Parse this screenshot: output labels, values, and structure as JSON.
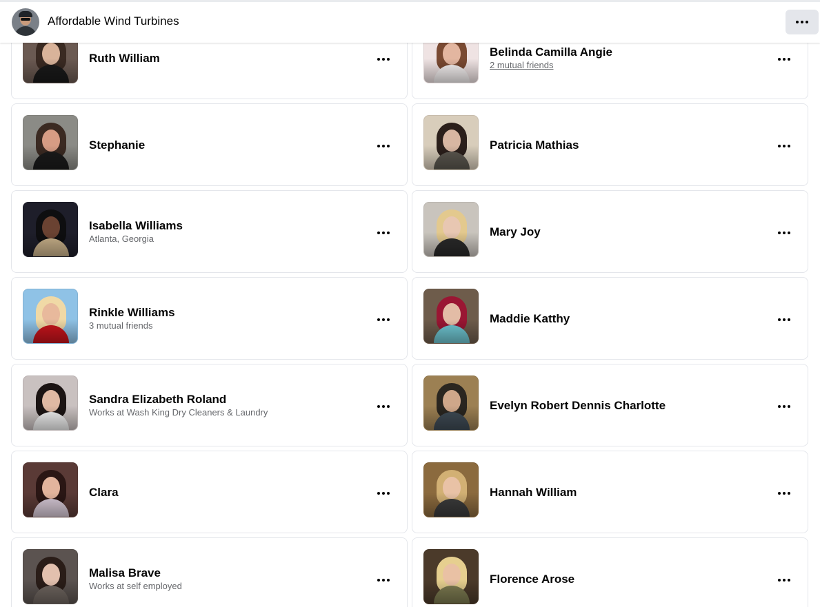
{
  "header": {
    "title": "Affordable Wind Turbines"
  },
  "people": [
    {
      "name": "Ruth William",
      "sub": "",
      "sub_link": false,
      "colors": {
        "bg": "#6b5a52",
        "hair": "#3a2a22",
        "skin": "#d9b39a",
        "cloth": "#1a1a1a"
      }
    },
    {
      "name": "Belinda Camilla Angie",
      "sub": "2 mutual friends",
      "sub_link": true,
      "colors": {
        "bg": "#efe3e3",
        "hair": "#7a4a32",
        "skin": "#e3b6a0",
        "cloth": "#f7f3f3"
      }
    },
    {
      "name": "Stephanie",
      "sub": "",
      "sub_link": false,
      "colors": {
        "bg": "#8b8b86",
        "hair": "#3b2a22",
        "skin": "#d69c84",
        "cloth": "#1b1b1b"
      }
    },
    {
      "name": "Patricia Mathias",
      "sub": "",
      "sub_link": false,
      "colors": {
        "bg": "#d8cdbb",
        "hair": "#2b1f1b",
        "skin": "#d8b6a2",
        "cloth": "#5c5850"
      }
    },
    {
      "name": "Isabella Williams",
      "sub": "Atlanta, Georgia",
      "sub_link": false,
      "colors": {
        "bg": "#1e1e2a",
        "hair": "#0e0e10",
        "skin": "#6a4232",
        "cloth": "#c8b18a"
      }
    },
    {
      "name": "Mary Joy",
      "sub": "",
      "sub_link": false,
      "colors": {
        "bg": "#c9c4bd",
        "hair": "#e3c98e",
        "skin": "#e8c7b2",
        "cloth": "#2a2a2a"
      }
    },
    {
      "name": "Rinkle Williams",
      "sub": "3 mutual friends",
      "sub_link": false,
      "colors": {
        "bg": "#8fc2e6",
        "hair": "#f0d9a6",
        "skin": "#e8b99c",
        "cloth": "#c8141c"
      }
    },
    {
      "name": "Maddie Katthy",
      "sub": "",
      "sub_link": false,
      "colors": {
        "bg": "#6e5c4b",
        "hair": "#9a1633",
        "skin": "#e3bca6",
        "cloth": "#6fc7d2"
      }
    },
    {
      "name": "Sandra Elizabeth Roland",
      "sub": "Works at Wash King Dry Cleaners & Laundry",
      "sub_link": false,
      "colors": {
        "bg": "#c9c1c0",
        "hair": "#1b1413",
        "skin": "#e0b9a3",
        "cloth": "#f1f1f1"
      }
    },
    {
      "name": "Evelyn Robert Dennis Charlotte",
      "sub": "",
      "sub_link": false,
      "colors": {
        "bg": "#9c8053",
        "hair": "#2a2620",
        "skin": "#cfa78a",
        "cloth": "#3f4b55"
      }
    },
    {
      "name": "Clara",
      "sub": "",
      "sub_link": false,
      "colors": {
        "bg": "#5a3a36",
        "hair": "#2a1614",
        "skin": "#e2b49d",
        "cloth": "#d7c8d6"
      }
    },
    {
      "name": "Hannah William",
      "sub": "",
      "sub_link": false,
      "colors": {
        "bg": "#8b6a3e",
        "hair": "#d2b074",
        "skin": "#e9c2a6",
        "cloth": "#3b3b3b"
      }
    },
    {
      "name": "Malisa Brave",
      "sub": "Works at self employed",
      "sub_link": false,
      "colors": {
        "bg": "#5b5350",
        "hair": "#2a1d18",
        "skin": "#e2c0ae",
        "cloth": "#6f6660"
      }
    },
    {
      "name": "Florence Arose",
      "sub": "",
      "sub_link": false,
      "colors": {
        "bg": "#4b3a2a",
        "hair": "#e6cf8f",
        "skin": "#e9c1a4",
        "cloth": "#7c7a50"
      }
    }
  ]
}
